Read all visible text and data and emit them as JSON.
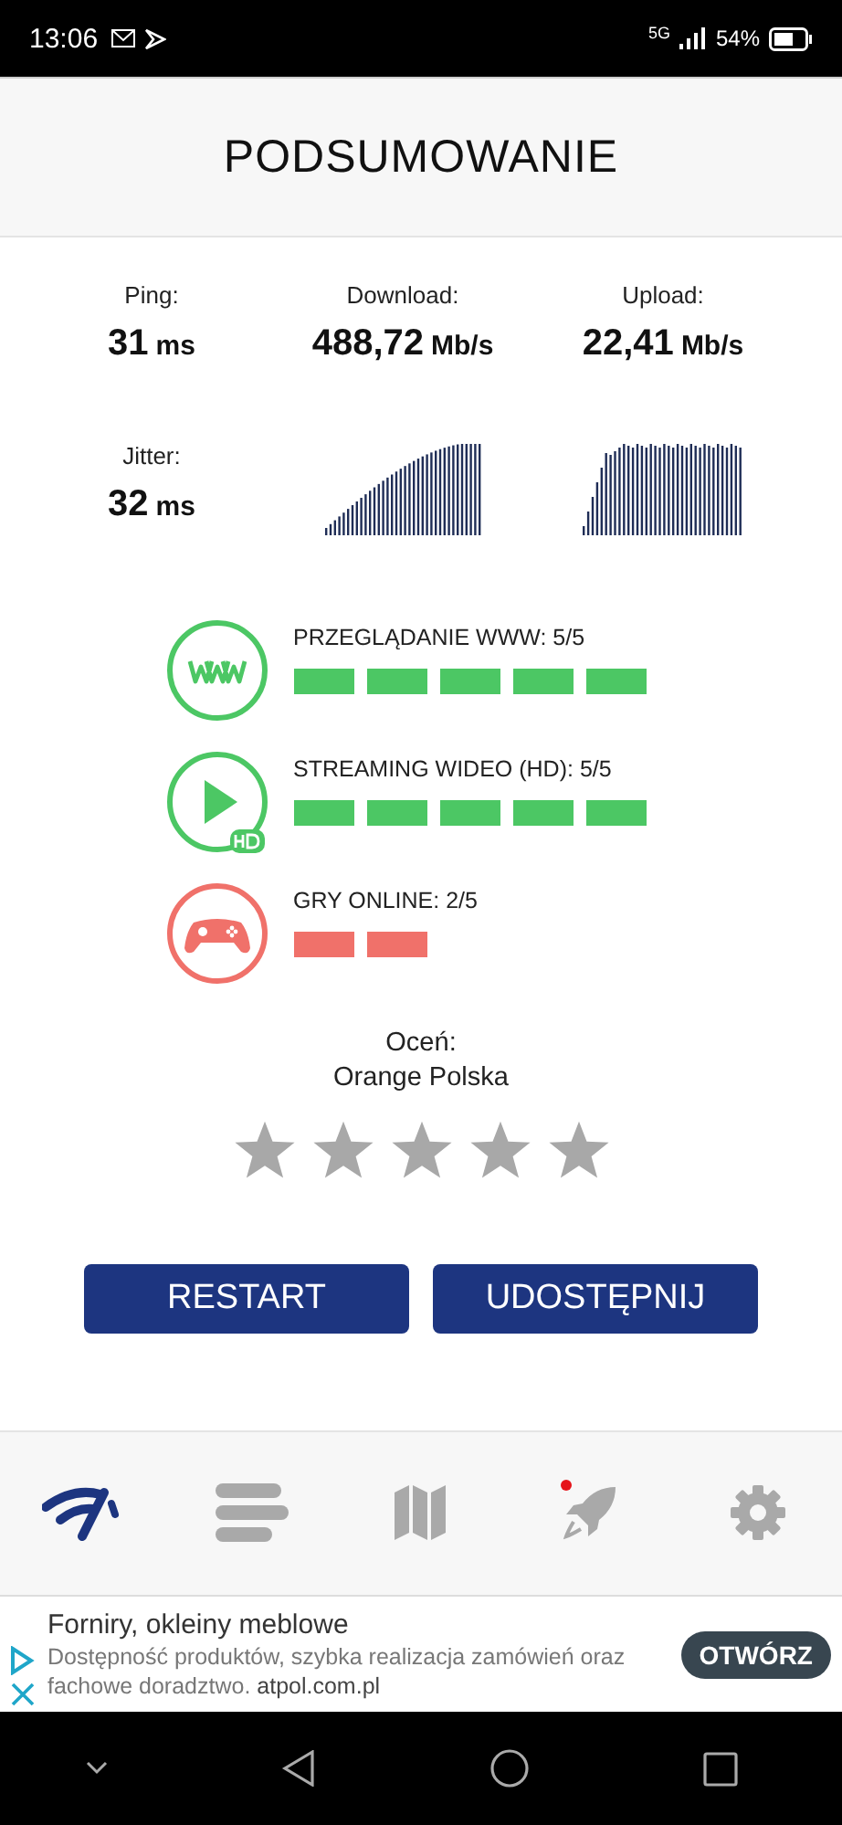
{
  "status_bar": {
    "time": "13:06",
    "network": "5G",
    "battery": "54%"
  },
  "header": {
    "title": "PODSUMOWANIE"
  },
  "metrics": [
    {
      "label": "Ping:",
      "value": "31",
      "unit": "ms"
    },
    {
      "label": "Download:",
      "value": "488,72",
      "unit": "Mb/s"
    },
    {
      "label": "Upload:",
      "value": "22,41",
      "unit": "Mb/s"
    },
    {
      "label": "Jitter:",
      "value": "32",
      "unit": "ms"
    }
  ],
  "quality": [
    {
      "kind": "www",
      "label": "PRZEGLĄDANIE WWW: 5/5",
      "segments": [
        {
          "kind": "filled"
        },
        {
          "kind": "filled"
        },
        {
          "kind": "filled"
        },
        {
          "kind": "filled"
        },
        {
          "kind": "filled"
        }
      ],
      "color": "#4cc764"
    },
    {
      "kind": "video",
      "label": "STREAMING WIDEO (HD): 5/5",
      "segments": [
        {
          "kind": "filled"
        },
        {
          "kind": "filled"
        },
        {
          "kind": "filled"
        },
        {
          "kind": "filled"
        },
        {
          "kind": "filled"
        }
      ],
      "color": "#4cc764"
    },
    {
      "kind": "games",
      "label": "GRY ONLINE: 2/5",
      "segments": [
        {
          "kind": "filled"
        },
        {
          "kind": "filled"
        }
      ],
      "color": "#f0716a"
    }
  ],
  "rating": {
    "prompt": "Oceń:",
    "operator": "Orange Polska",
    "stars": 0
  },
  "buttons": [
    "RESTART",
    "UDOSTĘPNIJ"
  ],
  "nav": [
    {
      "kind": "speed",
      "selected": true,
      "badge": false
    },
    {
      "kind": "list",
      "selected": false,
      "badge": false
    },
    {
      "kind": "map",
      "selected": false,
      "badge": false
    },
    {
      "kind": "rocket",
      "selected": false,
      "badge": true
    },
    {
      "kind": "settings",
      "selected": false,
      "badge": false
    }
  ],
  "ad": {
    "title": "Forniry, okleiny meblowe",
    "text": "Dostępność produktów, szybka realizacja zamówień oraz fachowe doradztwo.",
    "domain": "atpol.com.pl",
    "button": "OTWÓRZ"
  }
}
